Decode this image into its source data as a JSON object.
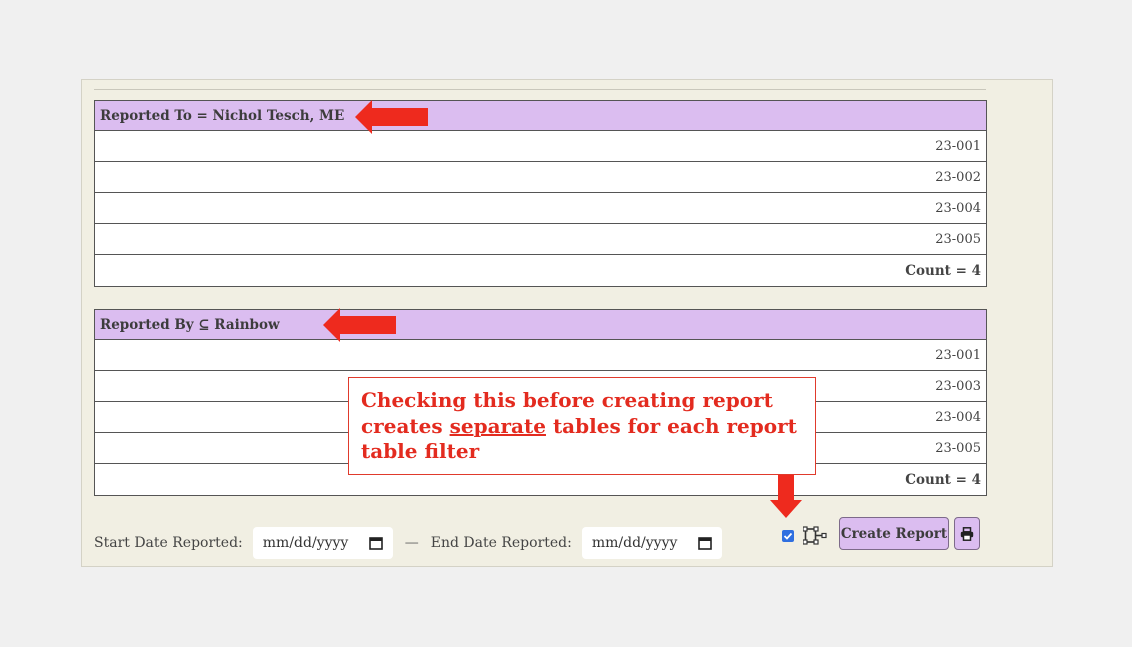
{
  "tables": [
    {
      "header": "Reported To = Nichol Tesch, ME",
      "rows": [
        "23-001",
        "23-002",
        "23-004",
        "23-005"
      ],
      "count": "Count = 4"
    },
    {
      "header": "Reported By ⊆ Rainbow",
      "rows": [
        "23-001",
        "23-003",
        "23-004",
        "23-005"
      ],
      "count": "Count = 4"
    }
  ],
  "callout": {
    "line1": "Checking this before creating report",
    "line2_pre": "creates ",
    "line2_u": "separate",
    "line2_post": " tables for each report",
    "line3": "table filter"
  },
  "filters": {
    "start_label": "Start Date Reported:",
    "start_placeholder": "mm/dd/yyyy",
    "dash": "—",
    "end_label": "End Date Reported:",
    "end_placeholder": "mm/dd/yyyy"
  },
  "actions": {
    "separate_tables_checked": true,
    "create_report_label": "Create Report",
    "icons": [
      "checkbox",
      "split-tables-icon",
      "printer-icon",
      "calendar-icon"
    ]
  },
  "colors": {
    "header_bg": "#dbbdf0",
    "annotation_red": "#e32b1f",
    "panel_bg": "#f1efe3"
  }
}
